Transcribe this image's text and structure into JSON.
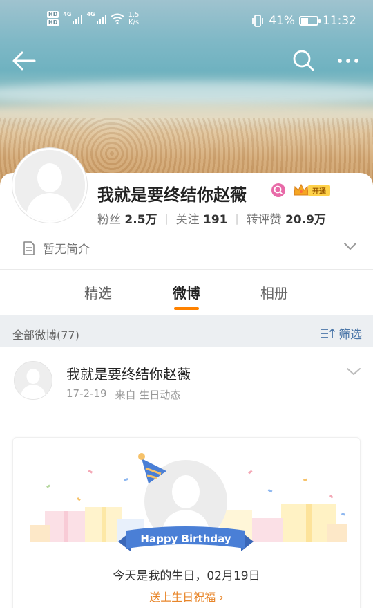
{
  "status_bar": {
    "hd_badges": [
      "HD",
      "HD"
    ],
    "network": [
      "4G",
      "4G"
    ],
    "speed_value": "1.5",
    "speed_unit": "K/s",
    "battery": "41%",
    "time": "11:32"
  },
  "profile": {
    "name": "我就是要终结你赵薇",
    "vip_label": "开通",
    "fans_label": "粉丝",
    "fans_value": "2.5万",
    "follow_label": "关注",
    "follow_value": "191",
    "likes_label": "转评赞",
    "likes_value": "20.9万",
    "bio": "暂无简介"
  },
  "tabs": [
    {
      "label": "精选",
      "active": false
    },
    {
      "label": "微博",
      "active": true
    },
    {
      "label": "相册",
      "active": false
    }
  ],
  "filter_bar": {
    "count_label": "全部微博(77)",
    "filter_label": "筛选"
  },
  "post": {
    "author": "我就是要终结你赵薇",
    "date": "17-2-19",
    "source": "来自 生日动态",
    "banner_text": "Happy Birthday",
    "message": "今天是我的生日，02月19日",
    "action": "送上生日祝福 ›"
  },
  "colors": {
    "accent": "#ff8200",
    "link": "#4a76a8",
    "birthday_link": "#e8862a",
    "ribbon": "#4a7fd6"
  }
}
